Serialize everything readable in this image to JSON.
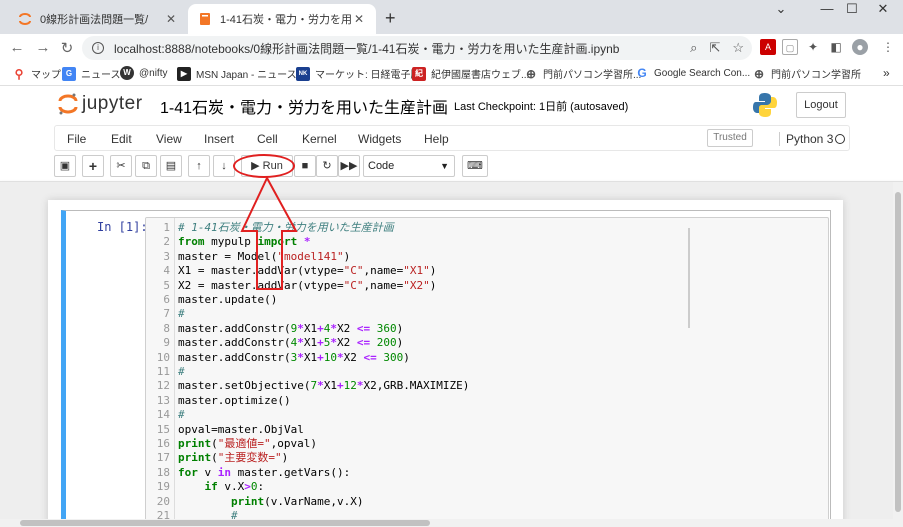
{
  "browser": {
    "tabs": [
      {
        "title": "0線形計画法問題一覧/",
        "active": false
      },
      {
        "title": "1-41石炭・電力・労力を用いた生産",
        "active": true
      }
    ],
    "new_tab": "+",
    "window_controls": [
      "⌄",
      "—",
      "☐",
      "✕"
    ],
    "url": "localhost:8888/notebooks/0線形計画法問題一覧/1-41石炭・電力・労力を用いた生産計画.ipynb",
    "bookmarks": [
      {
        "label": "マップ",
        "icon": "map-pin-icon",
        "color": "#ea4335"
      },
      {
        "label": "ニュース",
        "icon": "google-news-icon",
        "color": "#4285f4"
      },
      {
        "label": "@nifty",
        "icon": "nifty-icon",
        "color": "#333333"
      },
      {
        "label": "MSN Japan - ニュース...",
        "icon": "msn-icon",
        "color": "#222222"
      },
      {
        "label": "マーケット: 日経電子版",
        "icon": "nikkei-icon",
        "color": "#1a3f8f"
      },
      {
        "label": "紀伊國屋書店ウェブ...",
        "icon": "kinokuniya-icon",
        "color": "#cc2222"
      },
      {
        "label": "門前パソコン学習所...",
        "icon": "globe-icon",
        "color": "#555555"
      },
      {
        "label": "Google Search Con...",
        "icon": "google-icon",
        "color": "#4285f4"
      },
      {
        "label": "門前パソコン学習所",
        "icon": "globe-icon",
        "color": "#555555"
      }
    ],
    "more": "»"
  },
  "jupyter": {
    "logo_text": "jupyter",
    "notebook_title": "1-41石炭・電力・労力を用いた生産計画",
    "checkpoint": "Last Checkpoint: 1日前   (autosaved)",
    "logout": "Logout",
    "menu": [
      "File",
      "Edit",
      "View",
      "Insert",
      "Cell",
      "Kernel",
      "Widgets",
      "Help"
    ],
    "trusted": "Trusted",
    "kernel_name": "Python 3",
    "toolbar": {
      "run_label": "Run",
      "cell_type": "Code"
    },
    "cell_prompt": "In [1]:",
    "code_lines": [
      [
        {
          "t": "# 1-41石炭・電力・労力を用いた生産計画",
          "c": "cm"
        }
      ],
      [
        {
          "t": "from",
          "c": "kw"
        },
        {
          "t": " mypulp ",
          "c": "tx"
        },
        {
          "t": "import",
          "c": "kw"
        },
        {
          "t": " *",
          "c": "op"
        }
      ],
      [
        {
          "t": "master = Model(",
          "c": "tx"
        },
        {
          "t": "\"model141\"",
          "c": "st"
        },
        {
          "t": ")",
          "c": "tx"
        }
      ],
      [
        {
          "t": "X1 = master.addVar(vtype=",
          "c": "tx"
        },
        {
          "t": "\"C\"",
          "c": "st"
        },
        {
          "t": ",name=",
          "c": "tx"
        },
        {
          "t": "\"X1\"",
          "c": "st"
        },
        {
          "t": ")",
          "c": "tx"
        }
      ],
      [
        {
          "t": "X2 = master.addVar(vtype=",
          "c": "tx"
        },
        {
          "t": "\"C\"",
          "c": "st"
        },
        {
          "t": ",name=",
          "c": "tx"
        },
        {
          "t": "\"X2\"",
          "c": "st"
        },
        {
          "t": ")",
          "c": "tx"
        }
      ],
      [
        {
          "t": "master.update()",
          "c": "tx"
        }
      ],
      [
        {
          "t": "#",
          "c": "cm"
        }
      ],
      [
        {
          "t": "master.addConstr(",
          "c": "tx"
        },
        {
          "t": "9",
          "c": "nm"
        },
        {
          "t": "*",
          "c": "op"
        },
        {
          "t": "X1",
          "c": "tx"
        },
        {
          "t": "+",
          "c": "op"
        },
        {
          "t": "4",
          "c": "nm"
        },
        {
          "t": "*",
          "c": "op"
        },
        {
          "t": "X2 ",
          "c": "tx"
        },
        {
          "t": "<=",
          "c": "op"
        },
        {
          "t": " ",
          "c": "tx"
        },
        {
          "t": "360",
          "c": "nm"
        },
        {
          "t": ")",
          "c": "tx"
        }
      ],
      [
        {
          "t": "master.addConstr(",
          "c": "tx"
        },
        {
          "t": "4",
          "c": "nm"
        },
        {
          "t": "*",
          "c": "op"
        },
        {
          "t": "X1",
          "c": "tx"
        },
        {
          "t": "+",
          "c": "op"
        },
        {
          "t": "5",
          "c": "nm"
        },
        {
          "t": "*",
          "c": "op"
        },
        {
          "t": "X2 ",
          "c": "tx"
        },
        {
          "t": "<=",
          "c": "op"
        },
        {
          "t": " ",
          "c": "tx"
        },
        {
          "t": "200",
          "c": "nm"
        },
        {
          "t": ")",
          "c": "tx"
        }
      ],
      [
        {
          "t": "master.addConstr(",
          "c": "tx"
        },
        {
          "t": "3",
          "c": "nm"
        },
        {
          "t": "*",
          "c": "op"
        },
        {
          "t": "X1",
          "c": "tx"
        },
        {
          "t": "+",
          "c": "op"
        },
        {
          "t": "10",
          "c": "nm"
        },
        {
          "t": "*",
          "c": "op"
        },
        {
          "t": "X2 ",
          "c": "tx"
        },
        {
          "t": "<=",
          "c": "op"
        },
        {
          "t": " ",
          "c": "tx"
        },
        {
          "t": "300",
          "c": "nm"
        },
        {
          "t": ")",
          "c": "tx"
        }
      ],
      [
        {
          "t": "#",
          "c": "cm"
        }
      ],
      [
        {
          "t": "master.setObjective(",
          "c": "tx"
        },
        {
          "t": "7",
          "c": "nm"
        },
        {
          "t": "*",
          "c": "op"
        },
        {
          "t": "X1",
          "c": "tx"
        },
        {
          "t": "+",
          "c": "op"
        },
        {
          "t": "12",
          "c": "nm"
        },
        {
          "t": "*",
          "c": "op"
        },
        {
          "t": "X2,GRB.MAXIMIZE)",
          "c": "tx"
        }
      ],
      [
        {
          "t": "master.optimize()",
          "c": "tx"
        }
      ],
      [
        {
          "t": "#",
          "c": "cm"
        }
      ],
      [
        {
          "t": "opval=master.ObjVal",
          "c": "tx"
        }
      ],
      [
        {
          "t": "print",
          "c": "kw"
        },
        {
          "t": "(",
          "c": "tx"
        },
        {
          "t": "\"最適値=\"",
          "c": "st"
        },
        {
          "t": ",opval)",
          "c": "tx"
        }
      ],
      [
        {
          "t": "print",
          "c": "kw"
        },
        {
          "t": "(",
          "c": "tx"
        },
        {
          "t": "\"主要変数=\"",
          "c": "st"
        },
        {
          "t": ")",
          "c": "tx"
        }
      ],
      [
        {
          "t": "for",
          "c": "kw"
        },
        {
          "t": " v ",
          "c": "tx"
        },
        {
          "t": "in",
          "c": "op"
        },
        {
          "t": " master.getVars():",
          "c": "tx"
        }
      ],
      [
        {
          "t": "    ",
          "c": "tx"
        },
        {
          "t": "if",
          "c": "kw"
        },
        {
          "t": " v.X",
          "c": "tx"
        },
        {
          "t": ">",
          "c": "op"
        },
        {
          "t": "0",
          "c": "nm"
        },
        {
          "t": ":",
          "c": "tx"
        }
      ],
      [
        {
          "t": "        ",
          "c": "tx"
        },
        {
          "t": "print",
          "c": "kw"
        },
        {
          "t": "(v.VarName,v.X)",
          "c": "tx"
        }
      ],
      [
        {
          "t": "        #",
          "c": "cm"
        }
      ]
    ]
  }
}
